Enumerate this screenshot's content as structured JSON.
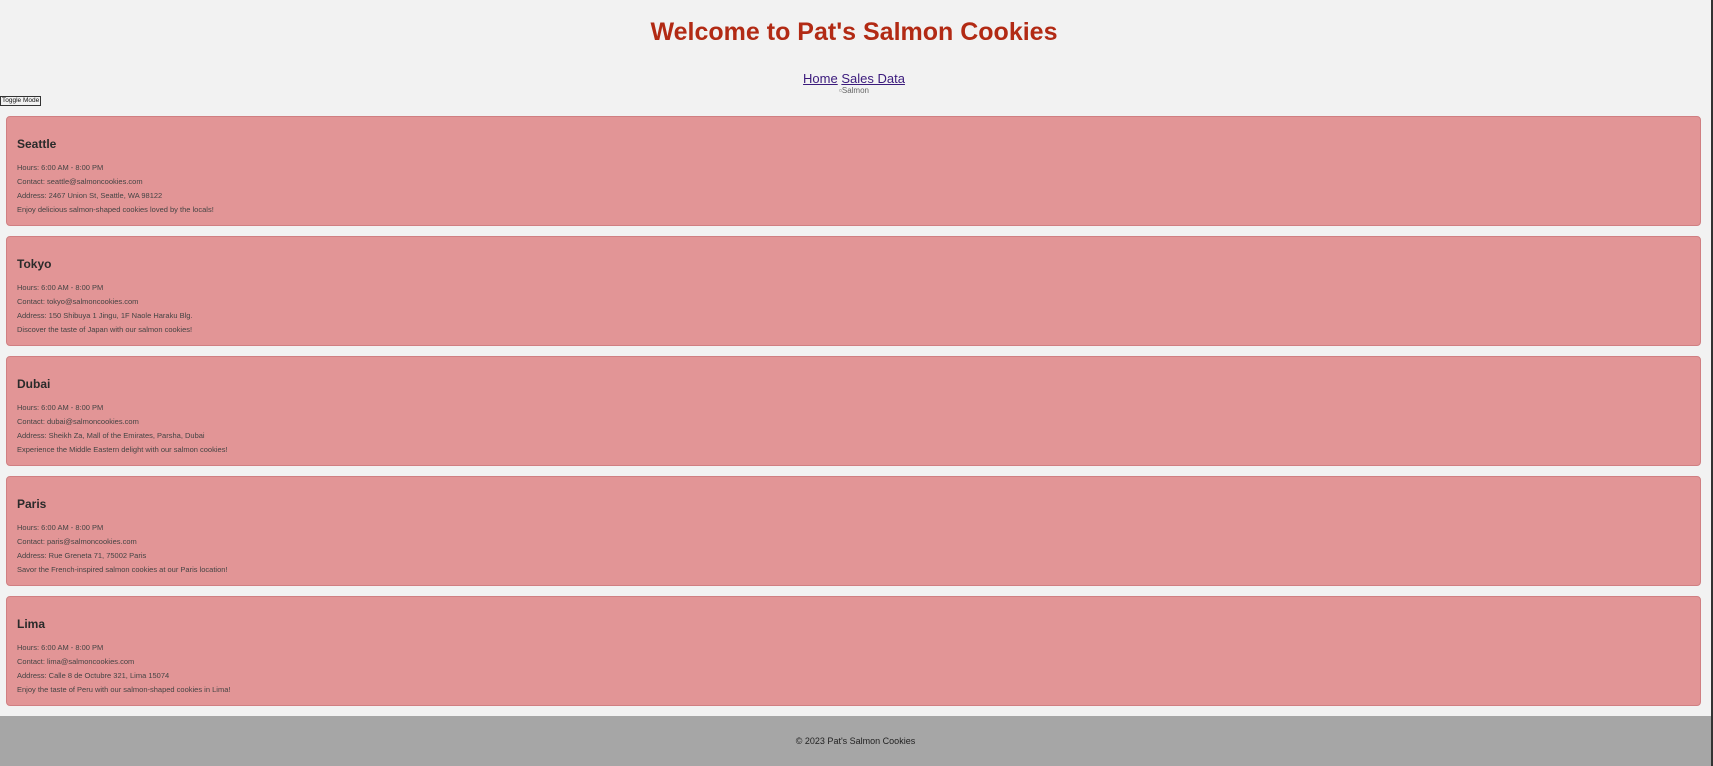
{
  "header": {
    "title": "Welcome to Pat's Salmon Cookies",
    "nav": {
      "home_label": "Home",
      "sales_label": "Sales Data"
    },
    "hero_alt": "Salmon"
  },
  "toggle_label": "Toggle Mode",
  "locations": [
    {
      "name": "Seattle",
      "hours": "Hours: 6:00 AM - 8:00 PM",
      "contact": "Contact: seattle@salmoncookies.com",
      "address": "Address: 2467 Union St, Seattle, WA 98122",
      "blurb": "Enjoy delicious salmon-shaped cookies loved by the locals!"
    },
    {
      "name": "Tokyo",
      "hours": "Hours: 6:00 AM - 8:00 PM",
      "contact": "Contact: tokyo@salmoncookies.com",
      "address": "Address: 150 Shibuya 1 Jingu, 1F Naole Haraku Blg.",
      "blurb": "Discover the taste of Japan with our salmon cookies!"
    },
    {
      "name": "Dubai",
      "hours": "Hours: 6:00 AM - 8:00 PM",
      "contact": "Contact: dubai@salmoncookies.com",
      "address": "Address: Sheikh Za, Mall of the Emirates, Parsha, Dubai",
      "blurb": "Experience the Middle Eastern delight with our salmon cookies!"
    },
    {
      "name": "Paris",
      "hours": "Hours: 6:00 AM - 8:00 PM",
      "contact": "Contact: paris@salmoncookies.com",
      "address": "Address: Rue Greneta 71, 75002 Paris",
      "blurb": "Savor the French-inspired salmon cookies at our Paris location!"
    },
    {
      "name": "Lima",
      "hours": "Hours: 6:00 AM - 8:00 PM",
      "contact": "Contact: lima@salmoncookies.com",
      "address": "Address: Calle 8 de Octubre 321, Lima 15074",
      "blurb": "Enjoy the taste of Peru with our salmon-shaped cookies in Lima!"
    }
  ],
  "footer": {
    "text": "© 2023 Pat's Salmon Cookies"
  },
  "colors": {
    "title": "#b22a14",
    "card_bg": "#e29596",
    "footer_bg": "#a6a6a6",
    "page_bg": "#f2f2f2",
    "link": "#3b1a7c"
  }
}
